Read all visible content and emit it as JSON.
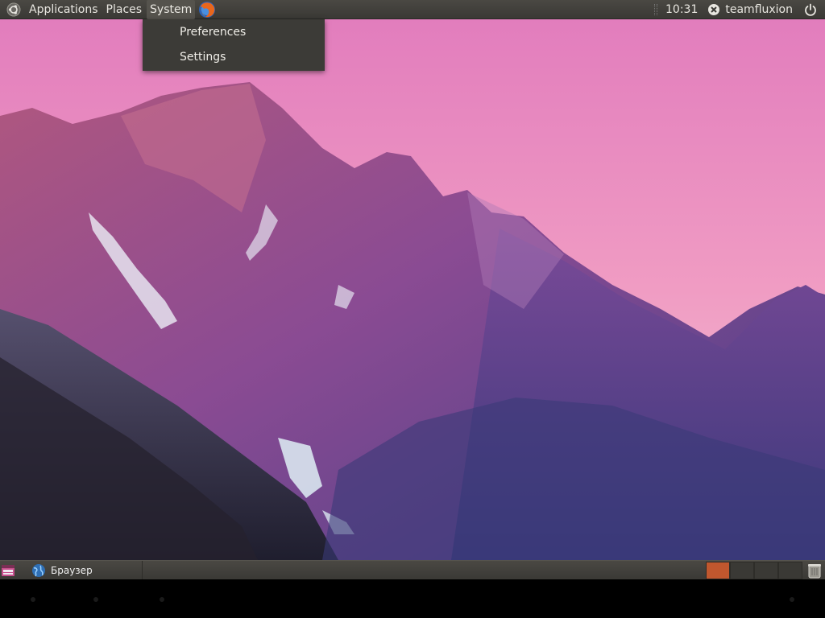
{
  "top_panel": {
    "menus": [
      "Applications",
      "Places",
      "System"
    ],
    "active_menu": "System",
    "clock": "10:31",
    "user": "teamfluxion"
  },
  "system_menu": {
    "items": [
      "Preferences",
      "Settings"
    ]
  },
  "bottom_panel": {
    "task_label": "Браузер",
    "workspace_count": 4,
    "active_workspace": 1
  },
  "colors": {
    "sky_top": "#e27dbd",
    "sky_bottom": "#f4c8d6",
    "mountain_light": "#8d4a8e",
    "mountain_dark": "#3a3a72",
    "active_workspace": "#c0572e"
  },
  "icons": {
    "main_menu": "ubuntu-logo-icon",
    "browser_launcher": "firefox-icon",
    "indicator": "x-icon",
    "session": "power-icon",
    "show_desktop": "show-desktop-icon",
    "task": "globe-icon",
    "trash": "trash-icon"
  }
}
